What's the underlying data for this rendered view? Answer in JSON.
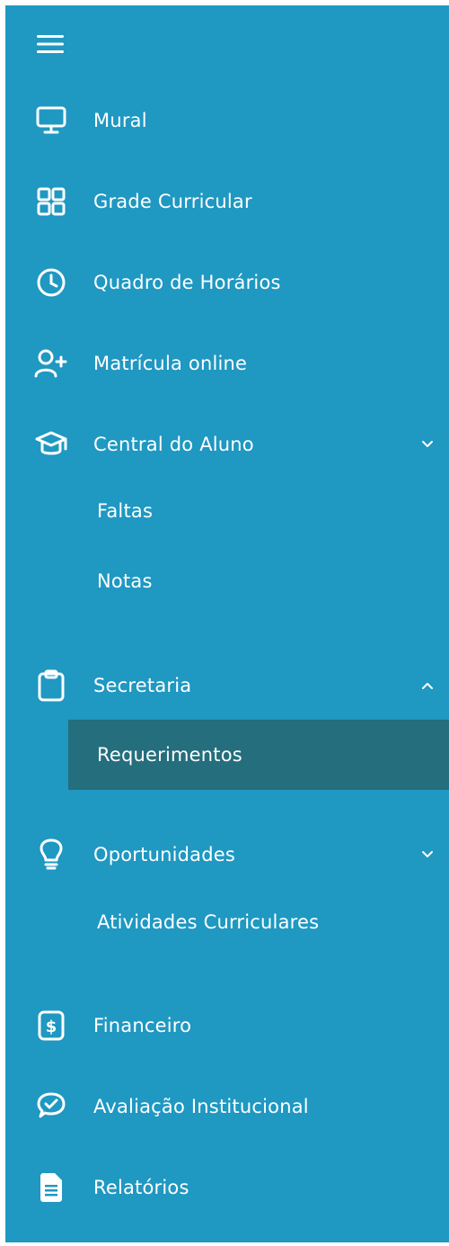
{
  "menu": {
    "items": [
      {
        "label": "Mural",
        "icon": "monitor-icon"
      },
      {
        "label": "Grade Curricular",
        "icon": "grid-icon"
      },
      {
        "label": "Quadro de Horários",
        "icon": "clock-icon"
      },
      {
        "label": "Matrícula online",
        "icon": "add-user-icon"
      },
      {
        "label": "Central do Aluno",
        "icon": "graduation-cap-icon",
        "expanded": false,
        "children": [
          {
            "label": "Faltas"
          },
          {
            "label": "Notas"
          }
        ]
      },
      {
        "label": "Secretaria",
        "icon": "clipboard-icon",
        "expanded": true,
        "children": [
          {
            "label": "Requerimentos",
            "active": true
          }
        ]
      },
      {
        "label": "Oportunidades",
        "icon": "lightbulb-icon",
        "expanded": false,
        "children": [
          {
            "label": "Atividades Curriculares"
          }
        ]
      },
      {
        "label": "Financeiro",
        "icon": "dollar-file-icon"
      },
      {
        "label": "Avaliação Institucional",
        "icon": "chat-check-icon"
      },
      {
        "label": "Relatórios",
        "icon": "report-file-icon"
      }
    ]
  },
  "colors": {
    "sidebar_bg": "#1f98c2",
    "active_bg": "#246e7d",
    "text": "#ffffff"
  }
}
